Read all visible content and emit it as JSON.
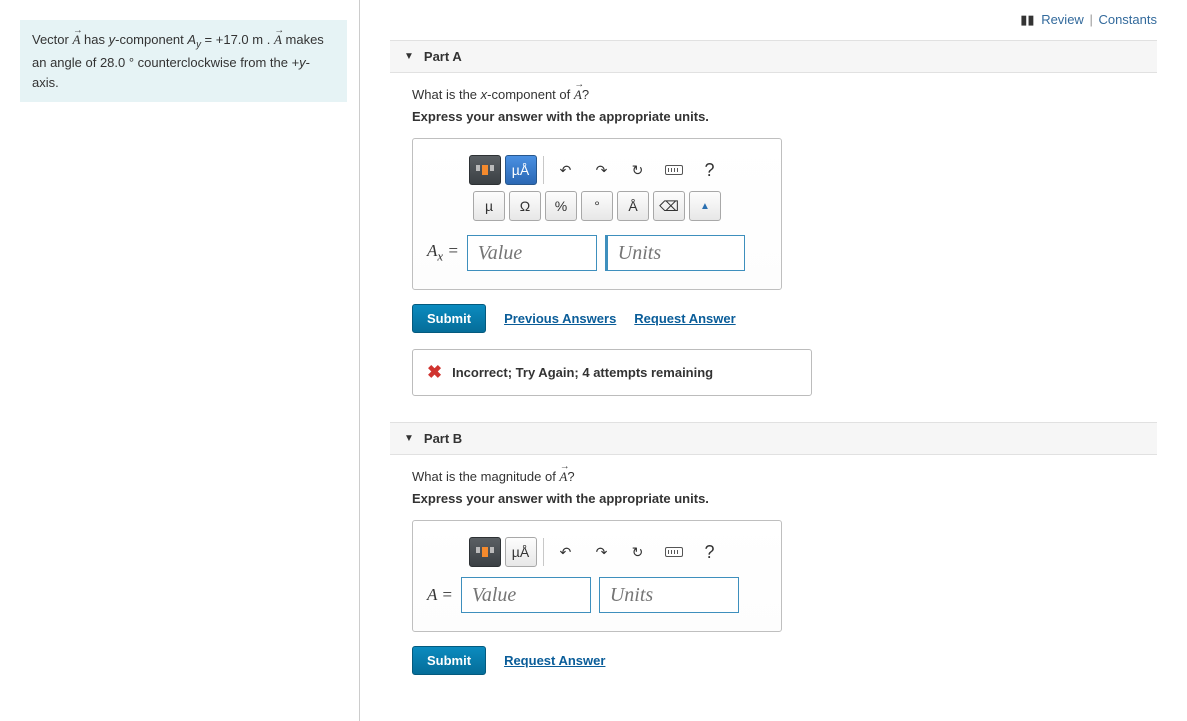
{
  "top": {
    "review": "Review",
    "constants": "Constants"
  },
  "problem": {
    "line1_pre": "Vector ",
    "line1_mid": " has ",
    "line1_ycomp": "y-component ",
    "Ay_eq": " = +17.0 m . ",
    "line2": "makes an angle of 28.0 ° counterclockwise from ",
    "line3": "the +y-axis."
  },
  "partA": {
    "header": "Part A",
    "question_pre": "What is the ",
    "question_mid": "x-component of ",
    "question_post": "?",
    "instruction": "Express your answer with the appropriate units.",
    "var_label": "Aₓ =",
    "value_ph": "Value",
    "units_ph": "Units",
    "submit": "Submit",
    "prev": "Previous Answers",
    "req": "Request Answer",
    "feedback": "Incorrect; Try Again; 4 attempts remaining"
  },
  "partB": {
    "header": "Part B",
    "question_pre": "What is the magnitude of ",
    "question_post": "?",
    "instruction": "Express your answer with the appropriate units.",
    "var_label": "A =",
    "value_ph": "Value",
    "units_ph": "Units",
    "submit": "Submit",
    "req": "Request Answer"
  },
  "toolbar": {
    "mu_angstrom": "µÅ",
    "undo": "↶",
    "redo": "↷",
    "reset": "↻",
    "help": "?",
    "mu": "µ",
    "omega": "Ω",
    "percent": "%",
    "degree": "°",
    "angstrom": "Å",
    "backspace": "⌫"
  }
}
